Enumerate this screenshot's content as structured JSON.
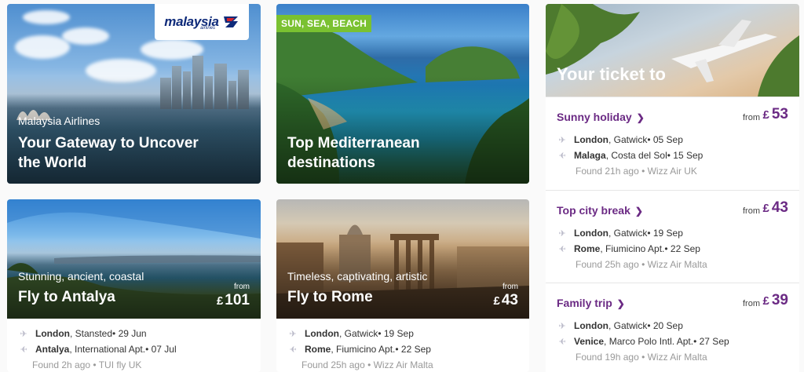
{
  "malaysia_card": {
    "logo_text": "malaysia",
    "logo_sub": "airlines",
    "kicker": "Malaysia Airlines",
    "title_line1": "Your Gateway to Uncover",
    "title_line2": "the World"
  },
  "med_card": {
    "badge": "SUN, SEA, BEACH",
    "title_line1": "Top Mediterranean",
    "title_line2": "destinations"
  },
  "panel": {
    "hero_title": "Your ticket to",
    "deals": [
      {
        "title": "Sunny holiday",
        "from": "from",
        "currency": "£",
        "price": "53",
        "out_city": "London",
        "out_airport": ", Gatwick",
        "out_date": " • 05 Sep",
        "ret_city": "Malaga",
        "ret_airport": ", Costa del Sol",
        "ret_date": " • 15 Sep",
        "found": "Found 21h ago • Wizz Air UK"
      },
      {
        "title": "Top city break",
        "from": "from",
        "currency": "£",
        "price": "43",
        "out_city": "London",
        "out_airport": ", Gatwick",
        "out_date": " • 19 Sep",
        "ret_city": "Rome",
        "ret_airport": ", Fiumicino Apt.",
        "ret_date": " • 22 Sep",
        "found": "Found 25h ago • Wizz Air Malta"
      },
      {
        "title": "Family trip",
        "from": "from",
        "currency": "£",
        "price": "39",
        "out_city": "London",
        "out_airport": ", Gatwick",
        "out_date": " • 20 Sep",
        "ret_city": "Venice",
        "ret_airport": ", Marco Polo Intl. Apt.",
        "ret_date": " • 27 Sep",
        "found": "Found 19h ago • Wizz Air Malta"
      }
    ]
  },
  "antalya_card": {
    "kicker": "Stunning, ancient, coastal",
    "title": "Fly to Antalya",
    "from": "from",
    "currency": "£",
    "price": "101",
    "out_city": "London",
    "out_airport": ", Stansted",
    "out_date": " • 29 Jun",
    "ret_city": "Antalya",
    "ret_airport": ", International Apt.",
    "ret_date": " • 07 Jul",
    "found": "Found 2h ago • TUI fly UK"
  },
  "rome_card": {
    "kicker": "Timeless, captivating, artistic",
    "title": "Fly to Rome",
    "from": "from",
    "currency": "£",
    "price": "43",
    "out_city": "London",
    "out_airport": ", Gatwick",
    "out_date": " • 19 Sep",
    "ret_city": "Rome",
    "ret_airport": ", Fiumicino Apt.",
    "ret_date": " • 22 Sep",
    "found": "Found 25h ago • Wizz Air Malta"
  },
  "colors": {
    "accent_purple": "#6b2a84",
    "badge_green": "#7ac131",
    "muted_text": "#999999",
    "plane_icon": "#b9b9c8"
  },
  "icons": [
    "plane-depart-icon",
    "plane-return-icon",
    "chevron-right-icon",
    "malaysia-airlines-logo-icon"
  ]
}
